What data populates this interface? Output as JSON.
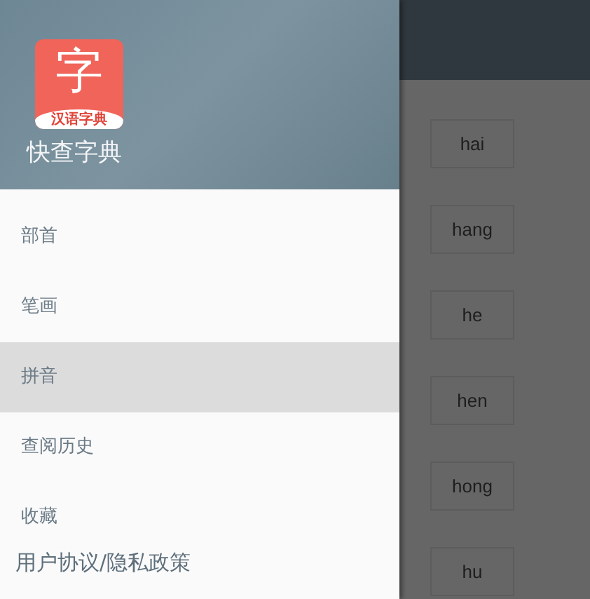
{
  "drawer": {
    "app_icon": {
      "glyph": "字",
      "caption": "汉语字典"
    },
    "app_name": "快查字典",
    "items": [
      {
        "kind": "menu",
        "label": "部首",
        "selected": false
      },
      {
        "kind": "menu",
        "label": "笔画",
        "selected": false
      },
      {
        "kind": "menu",
        "label": "拼音",
        "selected": true
      },
      {
        "kind": "menu",
        "label": "查阅历史",
        "selected": false
      },
      {
        "kind": "menu",
        "label": "收藏",
        "selected": false
      },
      {
        "kind": "footer",
        "label": "用户协议/隐私政策",
        "selected": false
      }
    ]
  },
  "pinyin_list": [
    "hai",
    "hang",
    "he",
    "hen",
    "hong",
    "hu"
  ]
}
